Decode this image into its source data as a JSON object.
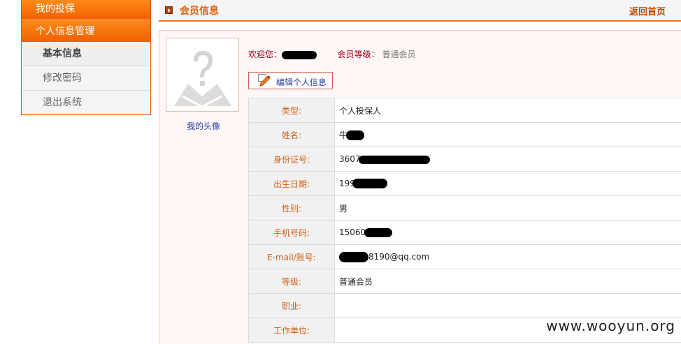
{
  "sidebar": {
    "sections": [
      "我的投保",
      "个人信息管理"
    ],
    "items": [
      {
        "label": "基本信息",
        "active": true
      },
      {
        "label": "修改密码",
        "active": false
      },
      {
        "label": "退出系统",
        "active": false
      }
    ]
  },
  "header": {
    "title": "会员信息",
    "back_link": "返回首页"
  },
  "avatar": {
    "label": "我的头像"
  },
  "welcome": {
    "greeting_label": "欢迎您：",
    "level_label": "会员等级：",
    "level_value": "普通会员"
  },
  "edit_button": {
    "label": "编辑个人信息"
  },
  "info_table": {
    "rows": [
      {
        "label": "类型:",
        "value": "个人投保人"
      },
      {
        "label": "姓名:",
        "value": "牛"
      },
      {
        "label": "身份证号:",
        "value": "3607"
      },
      {
        "label": "出生日期:",
        "value": "199"
      },
      {
        "label": "性别:",
        "value": "男"
      },
      {
        "label": "手机号码:",
        "value": "150607"
      },
      {
        "label": "E-mail/账号:",
        "value": "8190@qq.com"
      },
      {
        "label": "等级:",
        "value": "普通会员"
      },
      {
        "label": "职业:",
        "value": ""
      },
      {
        "label": "工作单位:",
        "value": ""
      }
    ]
  },
  "watermark": "www.wooyun.org",
  "colors": {
    "accent": "#f06000",
    "label": "#d06018",
    "link": "#2240a0"
  }
}
